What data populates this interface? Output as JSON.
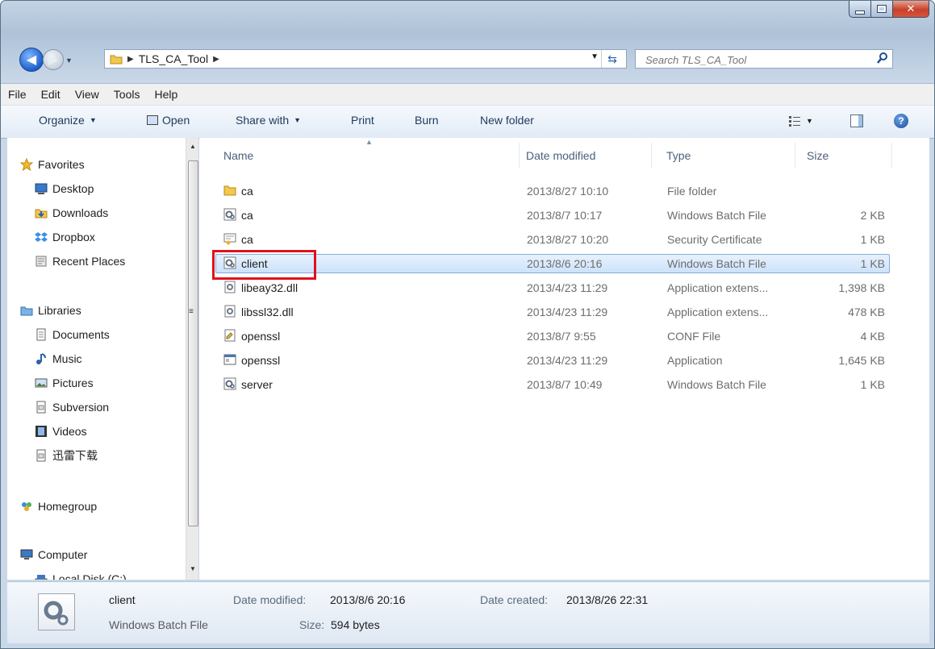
{
  "window": {
    "breadcrumb": "TLS_CA_Tool",
    "search_placeholder": "Search TLS_CA_Tool"
  },
  "menu": [
    "File",
    "Edit",
    "View",
    "Tools",
    "Help"
  ],
  "toolbar": {
    "organize": "Organize",
    "open": "Open",
    "share_with": "Share with",
    "print": "Print",
    "burn": "Burn",
    "new_folder": "New folder"
  },
  "nav": {
    "favorites": "Favorites",
    "favorites_items": [
      "Desktop",
      "Downloads",
      "Dropbox",
      "Recent Places"
    ],
    "libraries": "Libraries",
    "libraries_items": [
      "Documents",
      "Music",
      "Pictures",
      "Subversion",
      "Videos",
      "迅雷下载"
    ],
    "homegroup": "Homegroup",
    "computer": "Computer",
    "computer_items": [
      "Local Disk (C:)"
    ]
  },
  "columns": {
    "name": "Name",
    "date": "Date modified",
    "type": "Type",
    "size": "Size"
  },
  "files": [
    {
      "name": "ca",
      "date": "2013/8/27 10:10",
      "type": "File folder",
      "size": "",
      "icon": "folder-icon"
    },
    {
      "name": "ca",
      "date": "2013/8/7 10:17",
      "type": "Windows Batch File",
      "size": "2 KB",
      "icon": "batch-file-icon"
    },
    {
      "name": "ca",
      "date": "2013/8/27 10:20",
      "type": "Security Certificate",
      "size": "1 KB",
      "icon": "certificate-icon"
    },
    {
      "name": "client",
      "date": "2013/8/6 20:16",
      "type": "Windows Batch File",
      "size": "1 KB",
      "icon": "batch-file-icon"
    },
    {
      "name": "libeay32.dll",
      "date": "2013/4/23 11:29",
      "type": "Application extens...",
      "size": "1,398 KB",
      "icon": "dll-icon"
    },
    {
      "name": "libssl32.dll",
      "date": "2013/4/23 11:29",
      "type": "Application extens...",
      "size": "478 KB",
      "icon": "dll-icon"
    },
    {
      "name": "openssl",
      "date": "2013/8/7 9:55",
      "type": "CONF File",
      "size": "4 KB",
      "icon": "conf-file-icon"
    },
    {
      "name": "openssl",
      "date": "2013/4/23 11:29",
      "type": "Application",
      "size": "1,645 KB",
      "icon": "application-icon"
    },
    {
      "name": "server",
      "date": "2013/8/7 10:49",
      "type": "Windows Batch File",
      "size": "1 KB",
      "icon": "batch-file-icon"
    }
  ],
  "selected_file": "client",
  "details": {
    "name": "client",
    "type": "Windows Batch File",
    "date_modified_label": "Date modified:",
    "date_modified": "2013/8/6 20:16",
    "size_label": "Size:",
    "size": "594 bytes",
    "date_created_label": "Date created:",
    "date_created": "2013/8/26 22:31"
  }
}
